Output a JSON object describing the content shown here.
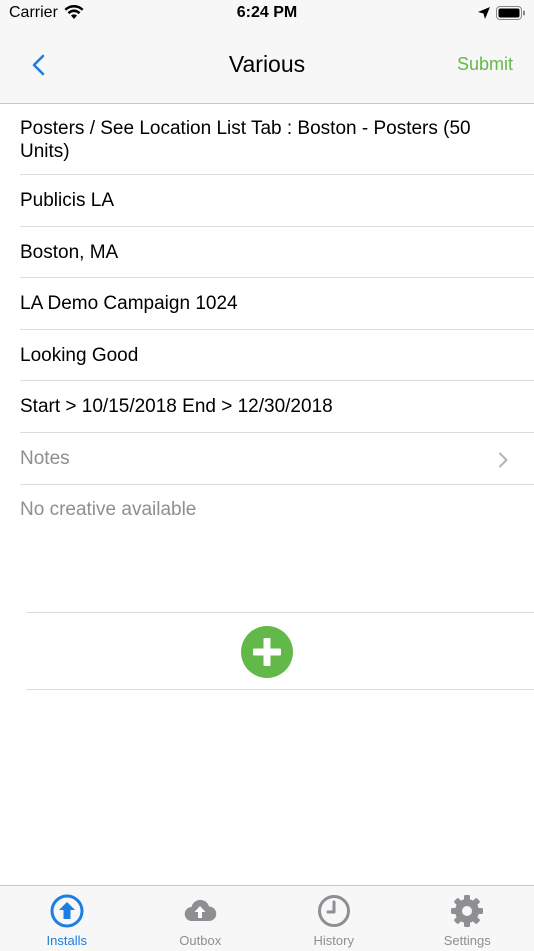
{
  "status_bar": {
    "carrier": "Carrier",
    "time": "6:24 PM"
  },
  "nav": {
    "title": "Various",
    "submit_label": "Submit",
    "accent_color": "#62b94a",
    "back_color": "#1a7fe0"
  },
  "details": {
    "item": "Posters / See Location List Tab : Boston - Posters (50 Units)",
    "client": "Publicis LA",
    "location": "Boston, MA",
    "campaign": "LA Demo Campaign 1024",
    "status": "Looking Good",
    "dates": "Start > 10/15/2018 End > 12/30/2018",
    "notes_label": "Notes",
    "creative_placeholder": "No creative available"
  },
  "add_button": {
    "icon": "plus-circle-icon",
    "color": "#62b94a"
  },
  "tabs": [
    {
      "label": "Installs",
      "icon": "upload-circle-icon",
      "active": true
    },
    {
      "label": "Outbox",
      "icon": "cloud-upload-icon",
      "active": false
    },
    {
      "label": "History",
      "icon": "clock-icon",
      "active": false
    },
    {
      "label": "Settings",
      "icon": "gear-icon",
      "active": false
    }
  ]
}
